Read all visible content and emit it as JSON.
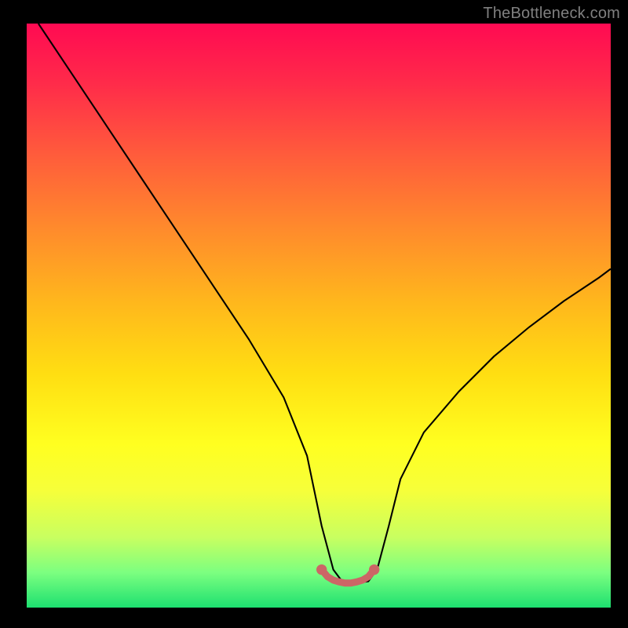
{
  "watermark": "TheBottleneck.com",
  "chart_data": {
    "type": "line",
    "title": "",
    "xlabel": "",
    "ylabel": "",
    "xlim": [
      0,
      100
    ],
    "ylim": [
      0,
      100
    ],
    "series": [
      {
        "name": "bottleneck-curve",
        "x": [
          2,
          8,
          14,
          20,
          26,
          32,
          38,
          44,
          48,
          50.5,
          52.5,
          54,
          56.5,
          58.5,
          60,
          62,
          64,
          68,
          74,
          80,
          86,
          92,
          98,
          100
        ],
        "y": [
          100,
          91,
          82,
          73,
          64,
          55,
          46,
          36,
          26,
          14,
          6.5,
          4.5,
          4.2,
          4.5,
          6.5,
          14,
          22,
          30,
          37,
          43,
          48,
          52.5,
          56.5,
          58
        ]
      },
      {
        "name": "flat-bottom-marker",
        "x": [
          50.5,
          51.5,
          52.5,
          53.5,
          54.5,
          55.5,
          56.5,
          57.5,
          58.5,
          59.5
        ],
        "y": [
          6.5,
          5.3,
          4.7,
          4.4,
          4.2,
          4.2,
          4.4,
          4.7,
          5.3,
          6.5
        ]
      }
    ],
    "colors": {
      "curve": "#000000",
      "flat_marker": "#cc6666",
      "gradient_top": "#ff0a52",
      "gradient_bottom": "#1de070"
    }
  }
}
